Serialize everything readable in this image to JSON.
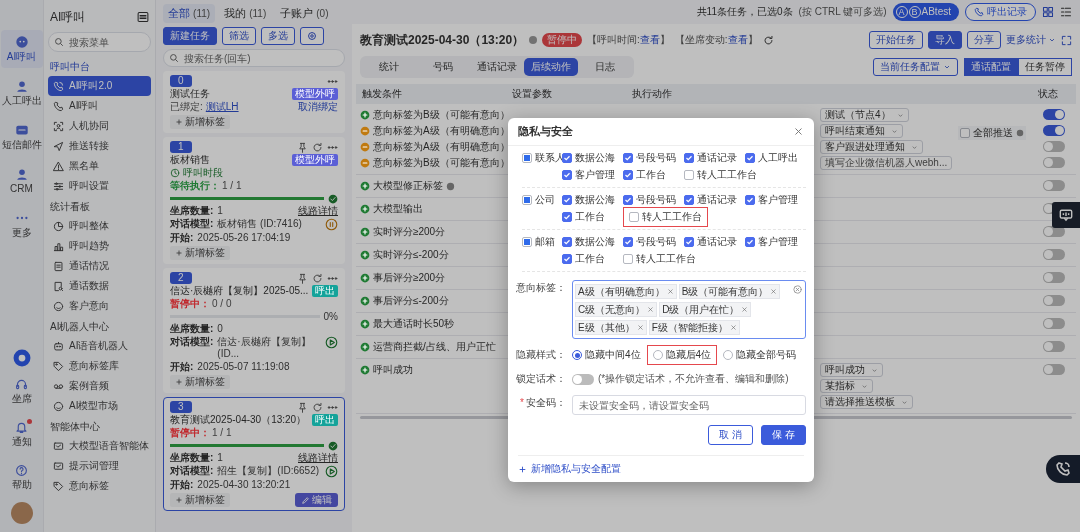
{
  "rail": {
    "items": [
      {
        "label": "AI呼叫",
        "selected": true
      },
      {
        "label": "人工呼出",
        "selected": false
      },
      {
        "label": "短信邮件",
        "selected": false
      },
      {
        "label": "CRM",
        "selected": false
      },
      {
        "label": "更多",
        "selected": false
      }
    ],
    "bottom": [
      {
        "label": "坐席",
        "unread": false
      },
      {
        "label": "通知",
        "unread": true
      },
      {
        "label": "帮助",
        "unread": false
      }
    ]
  },
  "nav": {
    "title": "AI呼叫",
    "search_placeholder": "搜索菜单",
    "sections": [
      {
        "title": "呼叫中台",
        "items": [
          {
            "label": "AI呼叫2.0",
            "selected": true
          },
          {
            "label": "AI呼叫",
            "selected": false
          },
          {
            "label": "人机协同",
            "selected": false
          },
          {
            "label": "推送转接",
            "selected": false
          },
          {
            "label": "黑名单",
            "selected": false
          },
          {
            "label": "呼叫设置",
            "selected": false
          }
        ]
      },
      {
        "title": "统计看板",
        "items": [
          {
            "label": "呼叫整体",
            "selected": false
          },
          {
            "label": "呼叫趋势",
            "selected": false
          },
          {
            "label": "通话情况",
            "selected": false
          },
          {
            "label": "通话数据",
            "selected": false
          },
          {
            "label": "客户意向",
            "selected": false
          }
        ]
      },
      {
        "title": "AI机器人中心",
        "items": [
          {
            "label": "AI语音机器人",
            "selected": false
          },
          {
            "label": "意向标签库",
            "selected": false
          },
          {
            "label": "案例音频",
            "selected": false
          },
          {
            "label": "AI模型市场",
            "selected": false
          }
        ]
      },
      {
        "title": "智能体中心",
        "items": [
          {
            "label": "大模型语音智能体",
            "selected": false
          },
          {
            "label": "提示词管理",
            "selected": false
          },
          {
            "label": "意向标签",
            "selected": false
          }
        ]
      }
    ]
  },
  "task_panel": {
    "scopes": [
      {
        "label": "全部",
        "count": "(11)",
        "selected": true
      },
      {
        "label": "我的",
        "count": "(11)",
        "selected": false
      },
      {
        "label": "子账户",
        "count": "(0)",
        "selected": false
      }
    ],
    "buttons": [
      "新建任务",
      "筛选",
      "多选"
    ],
    "search_placeholder": "搜索任务(回车)",
    "cards": [
      {
        "kind": "bound",
        "number": "0",
        "title": "测试任务",
        "tag": {
          "label": "模型外呼",
          "color": "#5b5fd6"
        },
        "bound_label": "已绑定:",
        "bound_link": "测试LH",
        "unbind": "取消绑定",
        "new_tag": "新增标签",
        "selected": false
      },
      {
        "kind": "task",
        "number": "1",
        "title": "板材销售",
        "tag": {
          "label": "模型外呼",
          "color": "#5b5fd6"
        },
        "schedule": "呼叫时段",
        "status": {
          "label": "等待执行：",
          "color": "#1f7a33"
        },
        "progress": "1 / 1",
        "level": 1,
        "rows": [
          {
            "label": "坐席数量:",
            "value": "1"
          },
          {
            "label": "对话模型:",
            "value": "板材销售 (ID:7416)"
          },
          {
            "label": "开始:",
            "value": "2025-05-26 17:04:19"
          }
        ],
        "line_link": "线路详情",
        "control": {
          "kind": "pause"
        },
        "new_tag": "新增标签",
        "selected": false
      },
      {
        "kind": "task",
        "number": "2",
        "title": "信达·辰樾府【复制】2025-05...",
        "tag": {
          "label": "呼出",
          "color": "#14a39a"
        },
        "status": {
          "label": "暂停中：",
          "color": "#c0282d"
        },
        "progress": "0 / 0",
        "level": 0,
        "percent": "0%",
        "rows": [
          {
            "label": "坐席数量:",
            "value": "0"
          },
          {
            "label": "对话模型:",
            "value": "信达·辰樾府【复制】(ID..."
          },
          {
            "label": "开始:",
            "value": "2025-05-07 11:19:08"
          }
        ],
        "control": {
          "kind": "play"
        },
        "new_tag": "新增标签",
        "selected": false
      },
      {
        "kind": "task",
        "number": "3",
        "title": "教育测试2025-04-30（13:20）",
        "tag": {
          "label": "呼出",
          "color": "#14a39a"
        },
        "status": {
          "label": "暂停中：",
          "color": "#c0282d"
        },
        "progress": "1 / 1",
        "level": 1,
        "rows": [
          {
            "label": "坐席数量:",
            "value": "1"
          },
          {
            "label": "对话模型:",
            "value": "招生【复制】(ID:6652)"
          },
          {
            "label": "开始:",
            "value": "2025-04-30 13:20:21"
          }
        ],
        "line_link": "线路详情",
        "control": {
          "kind": "play"
        },
        "new_tag": "新增标签",
        "edit": "编辑",
        "selected": true
      }
    ]
  },
  "header": {
    "summary": "共11条任务，已选0条",
    "hint": "(按 CTRL 键可多选)",
    "ab_letters": [
      "A",
      "B"
    ],
    "abtest": "ABtest",
    "export": "呼出记录",
    "title": "教育测试2025-04-30（13:20）",
    "status_badge": "暂停中",
    "meta": [
      {
        "label": "【呼叫时间:",
        "link": "查看",
        "suffix": "】"
      },
      {
        "label": "【坐席变动:",
        "link": "查看",
        "suffix": "】"
      }
    ],
    "actions": [
      {
        "label": "开始任务",
        "primary": false
      },
      {
        "label": "导入",
        "primary": true
      },
      {
        "label": "分享",
        "primary": false
      }
    ],
    "more": "更多统计",
    "tabs": [
      {
        "label": "统计",
        "selected": false
      },
      {
        "label": "号码",
        "selected": false
      },
      {
        "label": "通话记录",
        "selected": false
      },
      {
        "label": "后续动作",
        "selected": true
      },
      {
        "label": "日志",
        "selected": false
      }
    ],
    "config": "当前任务配置",
    "modes": [
      {
        "label": "通话配置",
        "selected": true
      },
      {
        "label": "任务暂停",
        "selected": false
      }
    ]
  },
  "table": {
    "columns": [
      "触发条件",
      "设置参数",
      "执行动作",
      "状态"
    ],
    "rows": [
      {
        "kind": "group",
        "conditions": [
          {
            "text": "意向标签为B级（可能有意向）",
            "kind": "plus",
            "color": "#1f7a33",
            "on": true
          },
          {
            "text": "意向标签为A级（有明确意向）",
            "kind": "minus",
            "color": "#c07a10",
            "on": true
          },
          {
            "text": "意向标签为A级（有明确意向）",
            "kind": "minus",
            "color": "#c07a10",
            "on": false
          },
          {
            "text": "意向标签为B级（可能有意向）",
            "kind": "minus",
            "color": "#c07a10",
            "on": false
          }
        ],
        "actions": [
          "测试（节点4）",
          "呼叫结束通知",
          "客户跟进处理通知"
        ],
        "action_placeholder": "填写企业微信机器人webh...",
        "push_all": {
          "label": "全部推送",
          "checked": false
        }
      },
      {
        "kind": "single",
        "conditions": [
          {
            "text": "大模型修正标签",
            "kind": "plus",
            "color": "#1f7a33",
            "on": false,
            "info": true
          }
        ]
      },
      {
        "kind": "single",
        "conditions": [
          {
            "text": "大模型输出",
            "kind": "plus",
            "color": "#1f7a33",
            "on": false
          }
        ]
      },
      {
        "kind": "single",
        "conditions": [
          {
            "text": "实时评分≥200分",
            "kind": "plus",
            "color": "#1f7a33",
            "on": false
          }
        ]
      },
      {
        "kind": "single",
        "conditions": [
          {
            "text": "实时评分≤-200分",
            "kind": "plus",
            "color": "#1f7a33",
            "on": false
          }
        ]
      },
      {
        "kind": "single",
        "conditions": [
          {
            "text": "事后评分≥200分",
            "kind": "plus",
            "color": "#1f7a33",
            "on": false
          }
        ]
      },
      {
        "kind": "single",
        "conditions": [
          {
            "text": "事后评分≤-200分",
            "kind": "plus",
            "color": "#1f7a33",
            "on": false
          }
        ]
      },
      {
        "kind": "single",
        "conditions": [
          {
            "text": "最大通话时长50秒",
            "kind": "plus",
            "color": "#1f7a33",
            "on": false
          }
        ]
      },
      {
        "kind": "single",
        "conditions": [
          {
            "text": "运营商拦截/占线、用户正忙",
            "kind": "plus",
            "color": "#1f7a33",
            "on": false
          }
        ]
      },
      {
        "kind": "single",
        "conditions": [
          {
            "text": "呼叫成功",
            "kind": "plus",
            "color": "#1f7a33",
            "on": false
          }
        ],
        "param": "呼叫成功",
        "actions": [
          "某指标",
          "请选择推送模板"
        ]
      }
    ]
  },
  "modal": {
    "title": "隐私与安全",
    "groups": [
      {
        "label": "联系人",
        "indeterminate": true,
        "options": [
          {
            "label": "数据公海",
            "checked": true,
            "highlighted": false
          },
          {
            "label": "号段号码",
            "checked": true,
            "highlighted": false
          },
          {
            "label": "通话记录",
            "checked": true,
            "highlighted": false
          },
          {
            "label": "人工呼出",
            "checked": true,
            "highlighted": false
          },
          {
            "label": "客户管理",
            "checked": true,
            "highlighted": false
          },
          {
            "label": "工作台",
            "checked": true,
            "highlighted": false
          },
          {
            "label": "转人工工作台",
            "checked": false,
            "highlighted": false
          }
        ]
      },
      {
        "label": "公司",
        "indeterminate": true,
        "options": [
          {
            "label": "数据公海",
            "checked": true,
            "highlighted": false
          },
          {
            "label": "号段号码",
            "checked": true,
            "highlighted": false
          },
          {
            "label": "通话记录",
            "checked": true,
            "highlighted": false
          },
          {
            "label": "客户管理",
            "checked": true,
            "highlighted": false
          },
          {
            "label": "工作台",
            "checked": true,
            "highlighted": false
          },
          {
            "label": "转人工工作台",
            "checked": false,
            "highlighted": true
          }
        ]
      },
      {
        "label": "邮箱",
        "indeterminate": true,
        "options": [
          {
            "label": "数据公海",
            "checked": true,
            "highlighted": false
          },
          {
            "label": "号段号码",
            "checked": true,
            "highlighted": false
          },
          {
            "label": "通话记录",
            "checked": true,
            "highlighted": false
          },
          {
            "label": "客户管理",
            "checked": true,
            "highlighted": false
          },
          {
            "label": "工作台",
            "checked": true,
            "highlighted": false
          },
          {
            "label": "转人工工作台",
            "checked": false,
            "highlighted": false
          }
        ]
      }
    ],
    "tags_label": "意向标签：",
    "tags": [
      "A级（有明确意向）",
      "B级（可能有意向）",
      "C级（无意向）",
      "D级（用户在忙）",
      "E级（其他）",
      "F级（智能拒接）"
    ],
    "mask_label": "隐藏样式：",
    "mask_options": [
      {
        "label": "隐藏中间4位",
        "selected": true,
        "highlighted": false
      },
      {
        "label": "隐藏后4位",
        "selected": false,
        "highlighted": true
      },
      {
        "label": "隐藏全部号码",
        "selected": false,
        "highlighted": false
      }
    ],
    "lock_label": "锁定话术：",
    "lock_on": false,
    "lock_hint": "(*操作锁定话术，不允许查看、编辑和删除)",
    "required_mark": "*",
    "code_label": "安全码：",
    "code_placeholder": "未设置安全码，请设置安全码",
    "cancel": "取 消",
    "save": "保 存",
    "add_link": "新增隐私与安全配置"
  }
}
